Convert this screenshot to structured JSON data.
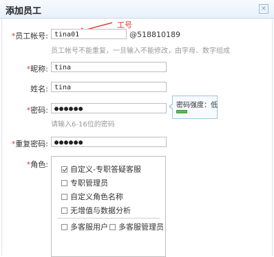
{
  "dialog": {
    "title": "添加员工",
    "close_glyph": "×"
  },
  "annotation": {
    "text": "工号"
  },
  "fields": {
    "account": {
      "label": "员工帐号:",
      "value": "tina01",
      "suffix": "@518810189",
      "hint": "员工帐号不能重复，一旦输入不能修改，由字母、数字组成",
      "required": true
    },
    "nickname": {
      "label": "昵称:",
      "value": "tina",
      "required": true
    },
    "name": {
      "label": "姓名:",
      "value": "tina",
      "required": false
    },
    "password": {
      "label": "密码:",
      "value": "●●●●●●",
      "hint": "请输入6-16位的密码",
      "required": true
    },
    "confirm_password": {
      "label": "重复密码:",
      "value": "●●●●●●",
      "required": true
    }
  },
  "strength": {
    "label": "密码强度：低",
    "level_fraction": 0.3,
    "color": "#5cb85c"
  },
  "roles": {
    "label": "角色:",
    "required": true,
    "items": [
      {
        "label": "自定义-专职答疑客服",
        "checked": true
      },
      {
        "label": "专职管理员",
        "checked": false
      },
      {
        "label": "自定义角色名称",
        "checked": false
      },
      {
        "label": "无增值与数据分析",
        "checked": false
      }
    ],
    "extra": [
      {
        "label": "多客服用户",
        "checked": false
      },
      {
        "label": "多客服管理员",
        "checked": false
      }
    ]
  },
  "colors": {
    "required_star": "#e03c31",
    "annotation": "#e03c31",
    "title_bar": "#e7f0fb"
  }
}
